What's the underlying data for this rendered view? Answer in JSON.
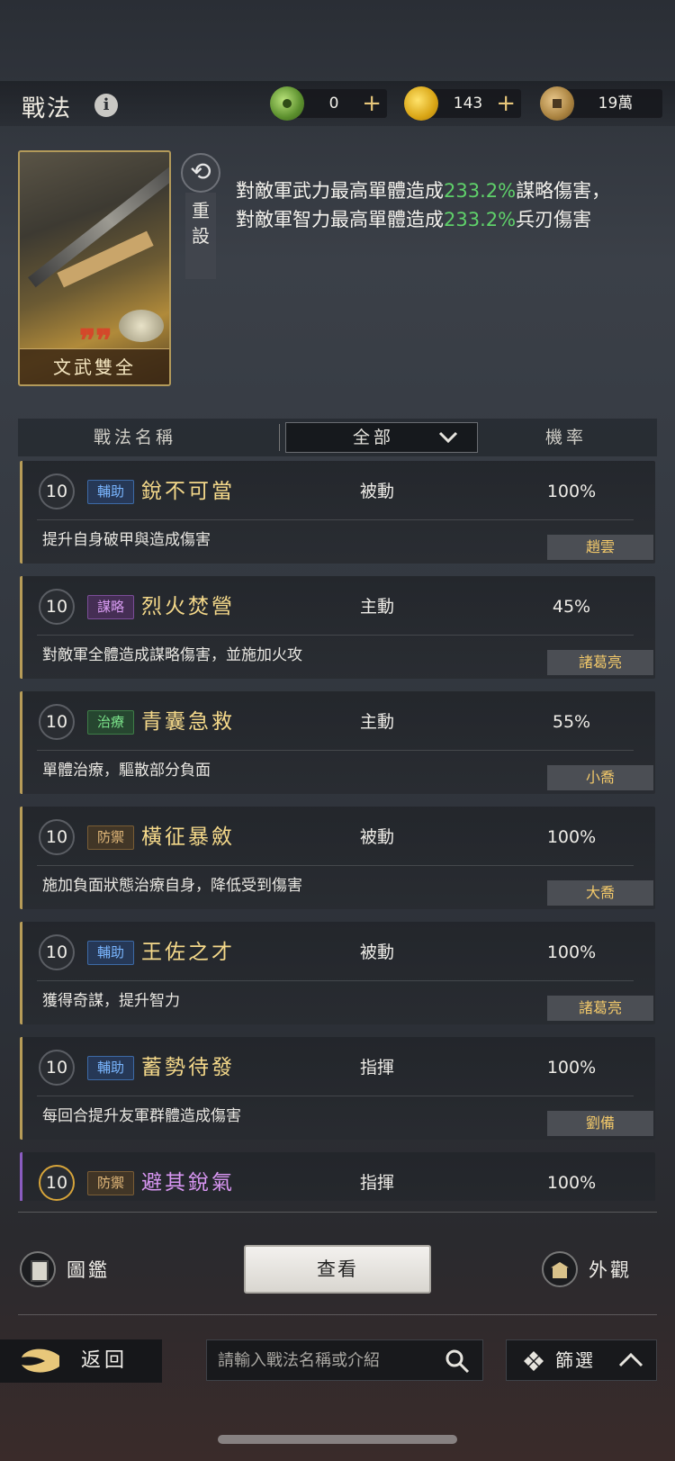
{
  "header": {
    "title": "戰法",
    "info_icon": "info-icon",
    "currencies": [
      {
        "icon": "jade-icon",
        "value": "0",
        "plus": "+"
      },
      {
        "icon": "gold-icon",
        "value": "143",
        "plus": "+"
      },
      {
        "icon": "coin-icon",
        "value": "19萬"
      }
    ]
  },
  "card": {
    "name": "文武雙全",
    "reset_label": "重設",
    "desc_parts": [
      "對敵軍武力最高單體造成",
      "233.2%",
      "謀略傷害，對敵軍智力最高單體造成",
      "233.2%",
      "兵刃傷害"
    ]
  },
  "table": {
    "col_name": "戰法名稱",
    "filter_value": "全部",
    "col_rate": "機率"
  },
  "skills": [
    {
      "level": "10",
      "tag": "輔助",
      "name": "銳不可當",
      "type": "被動",
      "rate": "100%",
      "desc": "提升自身破甲與造成傷害",
      "owner": "趙雲"
    },
    {
      "level": "10",
      "tag": "謀略",
      "name": "烈火焚營",
      "type": "主動",
      "rate": "45%",
      "desc": "對敵軍全體造成謀略傷害，並施加火攻",
      "owner": "諸葛亮"
    },
    {
      "level": "10",
      "tag": "治療",
      "name": "青囊急救",
      "type": "主動",
      "rate": "55%",
      "desc": "單體治療，驅散部分負面",
      "owner": "小喬"
    },
    {
      "level": "10",
      "tag": "防禦",
      "name": "橫征暴斂",
      "type": "被動",
      "rate": "100%",
      "desc": "施加負面狀態治療自身，降低受到傷害",
      "owner": "大喬"
    },
    {
      "level": "10",
      "tag": "輔助",
      "name": "王佐之才",
      "type": "被動",
      "rate": "100%",
      "desc": "獲得奇謀，提升智力",
      "owner": "諸葛亮"
    },
    {
      "level": "10",
      "tag": "輔助",
      "name": "蓄勢待發",
      "type": "指揮",
      "rate": "100%",
      "desc": "每回合提升友軍群體造成傷害",
      "owner": "劉備"
    },
    {
      "level": "10",
      "tag": "防禦",
      "name": "避其銳氣",
      "type": "指揮",
      "rate": "100%",
      "desc": "",
      "owner": ""
    }
  ],
  "bottom": {
    "tujian": "圖鑑",
    "view": "查看",
    "waiguan": "外觀",
    "back": "返回",
    "search_placeholder": "請輸入戰法名稱或介紹",
    "filter": "篩選"
  },
  "colors": {
    "highlight": "#5fd16a",
    "gold_name": "#f5d98a",
    "purple_name": "#d896f2"
  }
}
